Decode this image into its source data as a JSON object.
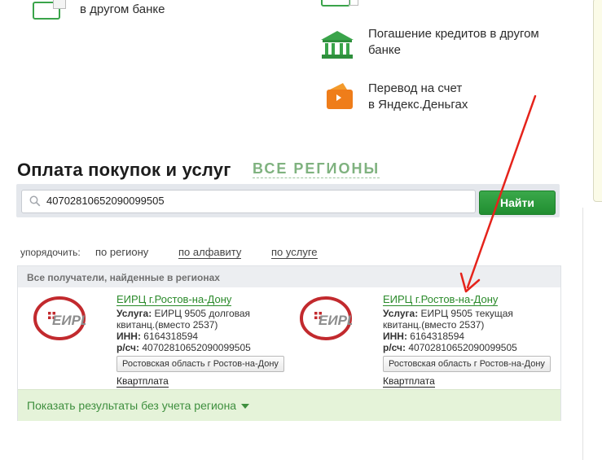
{
  "services": {
    "other_bank_label": "в другом банке",
    "loan_label_1": "Погашение кредитов в другом",
    "loan_label_2": "банке",
    "yandex_label_1": "Перевод на счет",
    "yandex_label_2": "в Яндекс.Деньгах"
  },
  "section": {
    "title": "Оплата покупок и услуг",
    "region_link": "ВСЕ РЕГИОНЫ"
  },
  "search": {
    "value": "40702810652090099505",
    "button_label": "Найти"
  },
  "sort": {
    "label": "упорядочить:",
    "by_region": "по региону",
    "by_alpha": "по алфавиту",
    "by_service": "по услуге"
  },
  "results": {
    "header": "Все получатели, найденные в регионах",
    "items": [
      {
        "name": "ЕИРЦ г.Ростов-на-Дону",
        "service_label": "Услуга:",
        "service_line1": "ЕИРЦ 9505 долговая",
        "service_line2": "квитанц.(вместо 2537)",
        "inn_label": "ИНН:",
        "inn": "6164318594",
        "account_label": "р/сч:",
        "account": "40702810652090099505",
        "region": "Ростовская область г Ростов-на-Дону",
        "category": "Квартплата"
      },
      {
        "name": "ЕИРЦ г.Ростов-на-Дону",
        "service_label": "Услуга:",
        "service_line1": "ЕИРЦ 9505 текущая",
        "service_line2": "квитанц.(вместо 2537)",
        "inn_label": "ИНН:",
        "inn": "6164318594",
        "account_label": "р/сч:",
        "account": "40702810652090099505",
        "region": "Ростовская область г Ростов-на-Дону",
        "category": "Квартплата"
      }
    ],
    "show_all": "Показать результаты без учета региона"
  },
  "logo_text": "ЕИРЦ",
  "colors": {
    "accent_green": "#2a8a2a",
    "button_green": "#2e9c3e",
    "annotation_red": "#e5231b",
    "show_bar_bg": "#e5f3d9"
  }
}
